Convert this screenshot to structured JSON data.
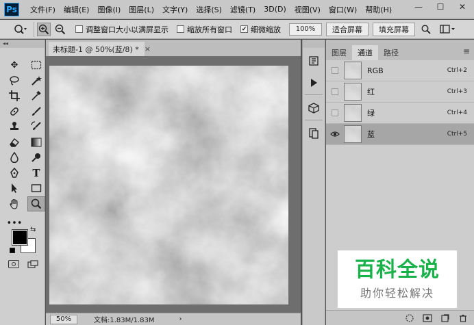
{
  "app": {
    "logo": "Ps"
  },
  "menu": [
    "文件(F)",
    "编辑(E)",
    "图像(I)",
    "图层(L)",
    "文字(Y)",
    "选择(S)",
    "滤镜(T)",
    "3D(D)",
    "视图(V)",
    "窗口(W)",
    "帮助(H)"
  ],
  "window_controls": {
    "minimize": "—",
    "maximize": "☐",
    "close": "✕"
  },
  "options": {
    "resize_windows_label": "调整窗口大小以满屏显示",
    "zoom_all_label": "缩放所有窗口",
    "scrubby_zoom_label": "细微缩放",
    "zoom_value": "100%",
    "fit_screen_label": "适合屏幕",
    "fill_screen_label": "填充屏幕"
  },
  "document": {
    "tab_title": "未标题-1 @ 50%(蓝/8) *",
    "close_glyph": "×"
  },
  "status": {
    "zoom": "50%",
    "doc_info": "文档:1.83M/1.83M",
    "arrow": "›"
  },
  "panel": {
    "tabs": [
      "图层",
      "通道",
      "路径"
    ],
    "active_tab": 1,
    "menu_glyph": "≡",
    "channels": [
      {
        "name": "RGB",
        "shortcut": "Ctrl+2",
        "visible": false,
        "selected": false
      },
      {
        "name": "红",
        "shortcut": "Ctrl+3",
        "visible": false,
        "selected": false
      },
      {
        "name": "绿",
        "shortcut": "Ctrl+4",
        "visible": false,
        "selected": false
      },
      {
        "name": "蓝",
        "shortcut": "Ctrl+5",
        "visible": true,
        "selected": true
      }
    ]
  },
  "icons": {
    "zoom_tool": "zoom-icon",
    "zoom_in": "zoom-in-icon",
    "zoom_out": "zoom-out-icon",
    "search": "search-icon",
    "workspace": "workspace-icon",
    "eye": "eye-icon"
  },
  "colors": {
    "foreground": "#000000",
    "background": "#ffffff",
    "accent_logo": "#31a8ff",
    "watermark_green": "#19b24a"
  },
  "watermark": {
    "main": "百科全说",
    "sub": "助你轻松解决"
  }
}
